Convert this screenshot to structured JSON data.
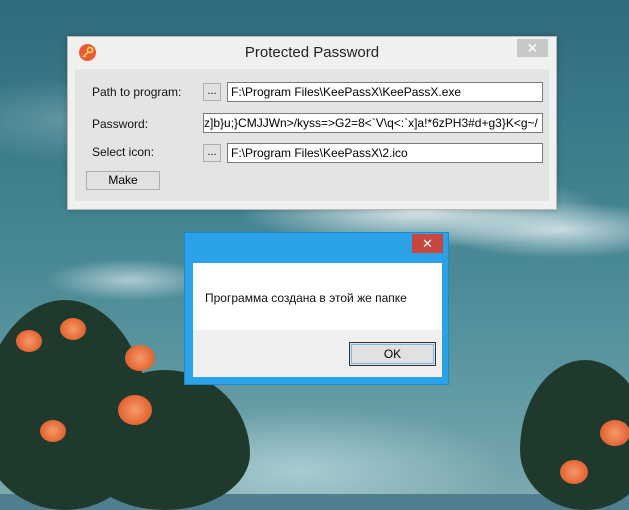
{
  "main_window": {
    "title": "Protected Password",
    "close_glyph": "✕",
    "app_icon": "key-icon",
    "path_label": "Path to program:",
    "path_value": "F:\\Program Files\\KeePassX\\KeePassX.exe",
    "password_label": "Password:",
    "password_value": "z]b}u;}CMJJWn>/kyss=>G2=8<`V\\q<:`x]a!*6zPH3#d+g3}K<g~/",
    "icon_label": "Select icon:",
    "icon_value": "F:\\Program Files\\KeePassX\\2.ico",
    "browse_label": "...",
    "make_label": "Make"
  },
  "message_box": {
    "close_glyph": "✕",
    "text": "Программа создана в этой же папке",
    "ok_label": "OK"
  },
  "colors": {
    "message_frame": "#2ba2e7",
    "close_red": "#c7463f",
    "app_icon_orange": "#e9593a"
  }
}
